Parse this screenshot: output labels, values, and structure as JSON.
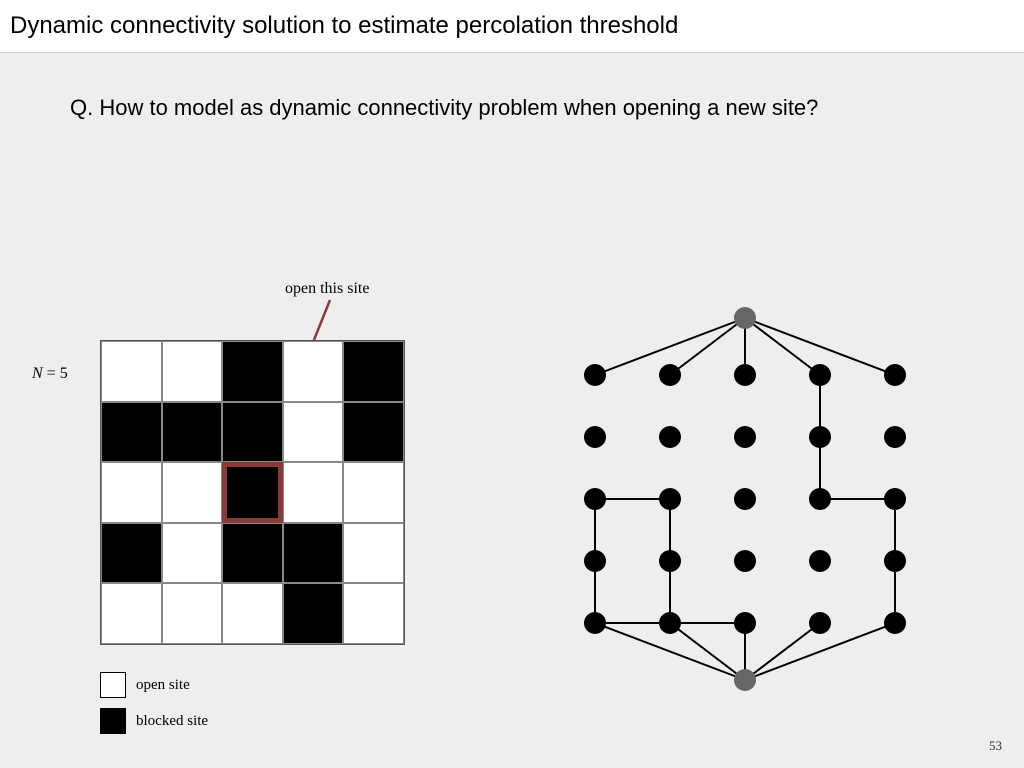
{
  "title": "Dynamic connectivity solution to estimate percolation threshold",
  "question": {
    "q": "Q.",
    "text": " How to model as dynamic connectivity problem when opening a new site?"
  },
  "annotation": "open this site",
  "n_label": {
    "n": "N",
    "eq": " = 5"
  },
  "legend": {
    "open": "open site",
    "blocked": "blocked site"
  },
  "page_number": "53",
  "grid": {
    "n": 5,
    "cells": [
      [
        "open",
        "open",
        "blocked",
        "open",
        "blocked"
      ],
      [
        "blocked",
        "blocked",
        "blocked",
        "open",
        "blocked"
      ],
      [
        "open",
        "open",
        "blocked",
        "open",
        "open"
      ],
      [
        "blocked",
        "open",
        "blocked",
        "blocked",
        "open"
      ],
      [
        "open",
        "open",
        "open",
        "blocked",
        "open"
      ]
    ],
    "highlight": {
      "row": 2,
      "col": 2
    }
  },
  "graph": {
    "virtual_top": true,
    "virtual_bottom": true,
    "nodes_per_row": 5,
    "rows": 5,
    "edges": [
      [
        "vtop",
        "0,0"
      ],
      [
        "vtop",
        "0,1"
      ],
      [
        "vtop",
        "0,2"
      ],
      [
        "vtop",
        "0,3"
      ],
      [
        "vtop",
        "0,4"
      ],
      [
        "0,3",
        "1,3"
      ],
      [
        "1,3",
        "2,3"
      ],
      [
        "2,0",
        "2,1"
      ],
      [
        "2,3",
        "2,4"
      ],
      [
        "2,0",
        "3,0"
      ],
      [
        "2,1",
        "3,1"
      ],
      [
        "2,4",
        "3,4"
      ],
      [
        "3,0",
        "4,0"
      ],
      [
        "3,1",
        "4,1"
      ],
      [
        "3,4",
        "4,4"
      ],
      [
        "4,0",
        "4,1"
      ],
      [
        "4,1",
        "4,2"
      ],
      [
        "4,0",
        "vbot"
      ],
      [
        "4,1",
        "vbot"
      ],
      [
        "4,2",
        "vbot"
      ],
      [
        "4,3",
        "vbot"
      ],
      [
        "4,4",
        "vbot"
      ]
    ]
  }
}
